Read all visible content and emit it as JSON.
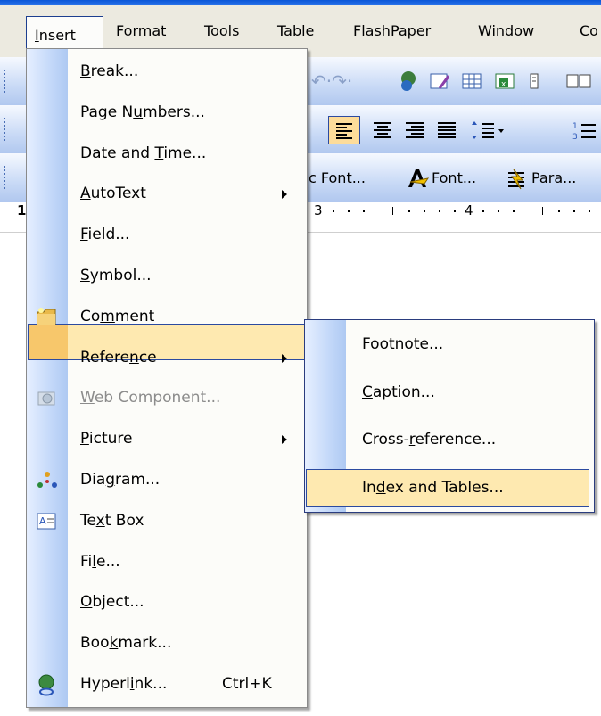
{
  "menubar": {
    "items": [
      {
        "pre": "",
        "ul": "I",
        "post": "nsert"
      },
      {
        "pre": "F",
        "ul": "o",
        "post": "rmat"
      },
      {
        "pre": "",
        "ul": "T",
        "post": "ools"
      },
      {
        "pre": "T",
        "ul": "a",
        "post": "ble"
      },
      {
        "pre": "Flash",
        "ul": "P",
        "post": "aper"
      },
      {
        "pre": "",
        "ul": "W",
        "post": "indow"
      },
      {
        "pre": "Co",
        "ul": "",
        "post": ""
      }
    ]
  },
  "toolbar": {
    "font_button": "Font...",
    "para_button": "Para...",
    "font_cut": "c Font...",
    "ruler_3": "3",
    "ruler_4": "4",
    "ruler_1": "1"
  },
  "insert_menu": {
    "items": [
      {
        "pre": "",
        "ul": "B",
        "post": "reak...",
        "icon": "",
        "shortcut": "",
        "submenu": false,
        "disabled": false
      },
      {
        "pre": "Page N",
        "ul": "u",
        "post": "mbers...",
        "icon": "",
        "shortcut": "",
        "submenu": false,
        "disabled": false
      },
      {
        "pre": "Date and ",
        "ul": "T",
        "post": "ime...",
        "icon": "",
        "shortcut": "",
        "submenu": false,
        "disabled": false
      },
      {
        "pre": "",
        "ul": "A",
        "post": "utoText",
        "icon": "",
        "shortcut": "",
        "submenu": true,
        "disabled": false
      },
      {
        "pre": "",
        "ul": "F",
        "post": "ield...",
        "icon": "",
        "shortcut": "",
        "submenu": false,
        "disabled": false
      },
      {
        "pre": "",
        "ul": "S",
        "post": "ymbol...",
        "icon": "",
        "shortcut": "",
        "submenu": false,
        "disabled": false
      },
      {
        "pre": "Co",
        "ul": "m",
        "post": "ment",
        "icon": "comment-icon",
        "shortcut": "",
        "submenu": false,
        "disabled": false
      },
      {
        "pre": "Refere",
        "ul": "n",
        "post": "ce",
        "icon": "",
        "shortcut": "",
        "submenu": true,
        "disabled": false
      },
      {
        "pre": "",
        "ul": "W",
        "post": "eb Component...",
        "icon": "web-component-icon",
        "shortcut": "",
        "submenu": false,
        "disabled": true
      },
      {
        "pre": "",
        "ul": "P",
        "post": "icture",
        "icon": "",
        "shortcut": "",
        "submenu": true,
        "disabled": false
      },
      {
        "pre": "Dia",
        "ul": "g",
        "post": "ram...",
        "icon": "diagram-icon",
        "shortcut": "",
        "submenu": false,
        "disabled": false
      },
      {
        "pre": "Te",
        "ul": "x",
        "post": "t Box",
        "icon": "text-box-icon",
        "shortcut": "",
        "submenu": false,
        "disabled": false
      },
      {
        "pre": "Fi",
        "ul": "l",
        "post": "e...",
        "icon": "",
        "shortcut": "",
        "submenu": false,
        "disabled": false
      },
      {
        "pre": "",
        "ul": "O",
        "post": "bject...",
        "icon": "",
        "shortcut": "",
        "submenu": false,
        "disabled": false
      },
      {
        "pre": "Boo",
        "ul": "k",
        "post": "mark...",
        "icon": "",
        "shortcut": "",
        "submenu": false,
        "disabled": false
      },
      {
        "pre": "Hyperl",
        "ul": "i",
        "post": "nk...",
        "icon": "hyperlink-icon",
        "shortcut": "Ctrl+K",
        "submenu": false,
        "disabled": false
      }
    ]
  },
  "reference_submenu": {
    "items": [
      {
        "pre": "Foot",
        "ul": "n",
        "post": "ote..."
      },
      {
        "pre": "",
        "ul": "C",
        "post": "aption..."
      },
      {
        "pre": "Cross-",
        "ul": "r",
        "post": "eference..."
      },
      {
        "pre": "In",
        "ul": "d",
        "post": "ex and Tables..."
      }
    ]
  },
  "colors": {
    "highlight_fill": "#fee9b0",
    "highlight_border": "#2b4aa0",
    "menu_bg": "#fcfcf9",
    "gutter_blue": "#c3d8f9"
  }
}
